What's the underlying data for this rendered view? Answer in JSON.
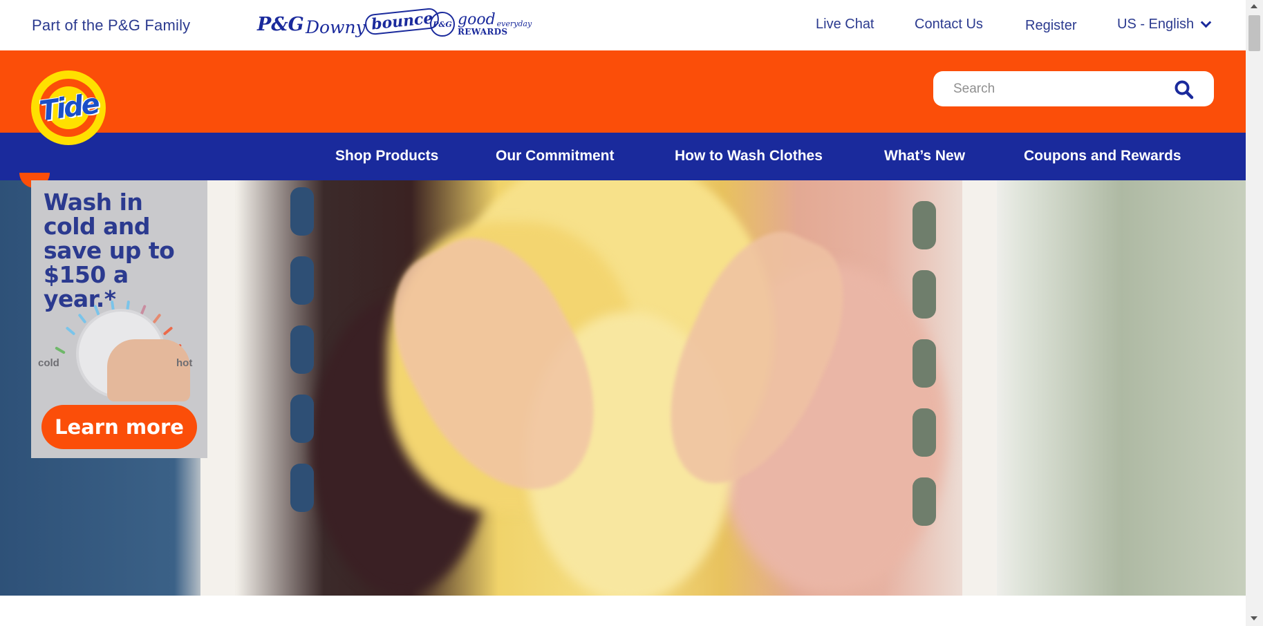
{
  "topbar": {
    "family_text": "Part of the P&G Family",
    "brands": {
      "pg": "P&G",
      "downy": "Downy",
      "bounce": "bounce",
      "pg_small": "P&G",
      "good": "good",
      "everyday": "everyday",
      "rewards": "REWARDS"
    },
    "links": {
      "live_chat": "Live Chat",
      "contact_us": "Contact Us",
      "register": "Register",
      "language": "US - English"
    }
  },
  "header": {
    "logo_text": "Tide",
    "search_placeholder": "Search",
    "search_icon": "search-icon"
  },
  "nav": {
    "items": [
      {
        "label": "Shop Products"
      },
      {
        "label": "Our Commitment"
      },
      {
        "label": "How to Wash Clothes"
      },
      {
        "label": "What’s New"
      },
      {
        "label": "Coupons and Rewards"
      }
    ]
  },
  "promo": {
    "headline_lines": [
      "Wash in",
      "cold and",
      "save up to",
      "$150 a year.*"
    ],
    "dial_cold": "cold",
    "dial_hot": "hot",
    "cta": "Learn more"
  },
  "colors": {
    "orange": "#fb4e09",
    "navy": "#1a2a9c",
    "yellow": "#ffe000"
  }
}
